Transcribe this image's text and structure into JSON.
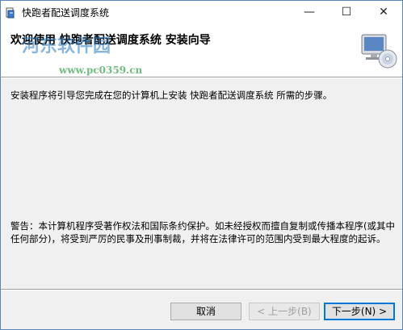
{
  "window": {
    "title": "快跑者配送调度系统",
    "controls": {
      "minimize": "—",
      "maximize": "☐",
      "close": "✕"
    }
  },
  "header": {
    "title": "欢迎使用 快跑者配送调度系统 安装向导",
    "watermark_text": "河东软件园",
    "watermark_url": "www.pc0359.cn",
    "icon": "computer-cd-icon"
  },
  "content": {
    "intro": "安装程序将引导您完成在您的计算机上安装 快跑者配送调度系统 所需的步骤。",
    "warning": "警告：本计算机程序受著作权法和国际条约保护。如未经授权而擅自复制或传播本程序(或其中任何部分)，将受到严厉的民事及刑事制裁，并将在法律许可的范围内受到最大程度的起诉。"
  },
  "buttons": {
    "cancel": "取消",
    "back": "< 上一步(B)",
    "next": "下一步(N) >"
  },
  "colors": {
    "accent": "#0078d7",
    "window_border": "#5a87b8"
  }
}
